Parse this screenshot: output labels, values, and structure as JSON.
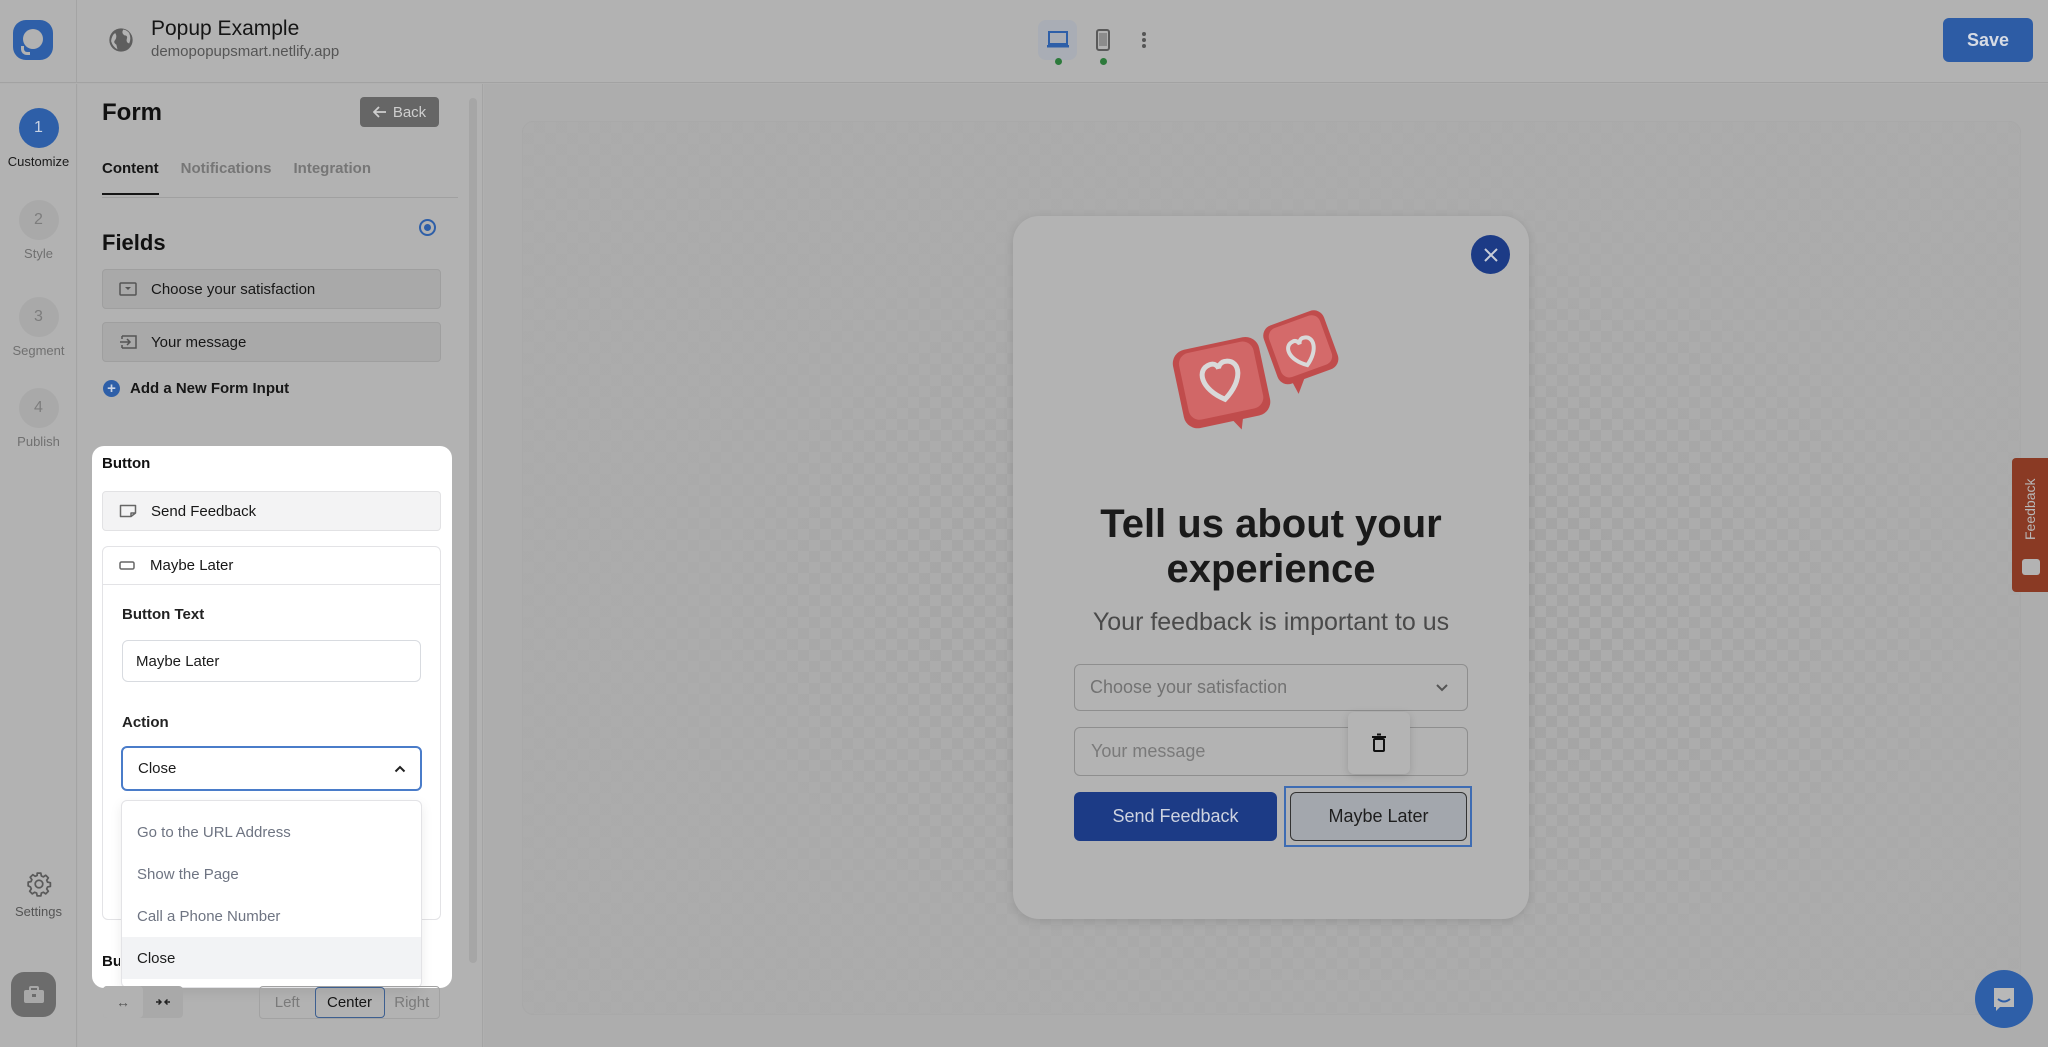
{
  "app": {
    "title": "Popup Example",
    "url": "demopopupsmart.netlify.app",
    "save_label": "Save",
    "device_buttons": [
      {
        "name": "desktop",
        "active": true
      },
      {
        "name": "mobile",
        "active": false
      }
    ]
  },
  "steps": [
    {
      "number": "1",
      "label": "Customize",
      "active": true
    },
    {
      "number": "2",
      "label": "Style",
      "active": false
    },
    {
      "number": "3",
      "label": "Segment",
      "active": false
    },
    {
      "number": "4",
      "label": "Publish",
      "active": false
    }
  ],
  "settings_label": "Settings",
  "panel": {
    "title": "Form",
    "back_label": "Back",
    "tabs": [
      {
        "label": "Content",
        "active": true
      },
      {
        "label": "Notifications",
        "active": false
      },
      {
        "label": "Integration",
        "active": false
      }
    ],
    "fields_title": "Fields",
    "fields": [
      {
        "label": "Choose your satisfaction",
        "icon": "dropdown-field-icon"
      },
      {
        "label": "Your message",
        "icon": "text-input-field-icon"
      }
    ],
    "add_input_label": "Add a New Form Input",
    "button_section": {
      "title": "Button",
      "buttons": [
        {
          "label": "Send Feedback",
          "icon": "sticky-note-icon"
        },
        {
          "label": "Maybe Later",
          "icon": "button-outline-icon",
          "expanded": true
        }
      ],
      "button_text_label": "Button Text",
      "button_text_value": "Maybe Later",
      "action_label": "Action",
      "action_value": "Close",
      "action_options": [
        "Go to the URL Address",
        "Show the Page",
        "Call a Phone Number",
        "Close"
      ],
      "action_selected_index": 3,
      "next_section_label_partial": "Bu"
    },
    "alignment": {
      "width_options": [
        "full-width",
        "fit-width"
      ],
      "options": [
        "Left",
        "Center",
        "Right"
      ],
      "selected": "Center"
    }
  },
  "popup": {
    "heading": "Tell us about your experience",
    "subheading": "Your feedback is important to us",
    "select_placeholder": "Choose your satisfaction",
    "message_placeholder": "Your message",
    "primary_button": "Send Feedback",
    "secondary_button": "Maybe Later"
  },
  "feedback_tab_label": "Feedback",
  "colors": {
    "brand": "#2e5fa8",
    "popup_primary": "#1c3b86",
    "feedback_tab": "#8a3a24",
    "status_dot": "#2d7a3b"
  }
}
